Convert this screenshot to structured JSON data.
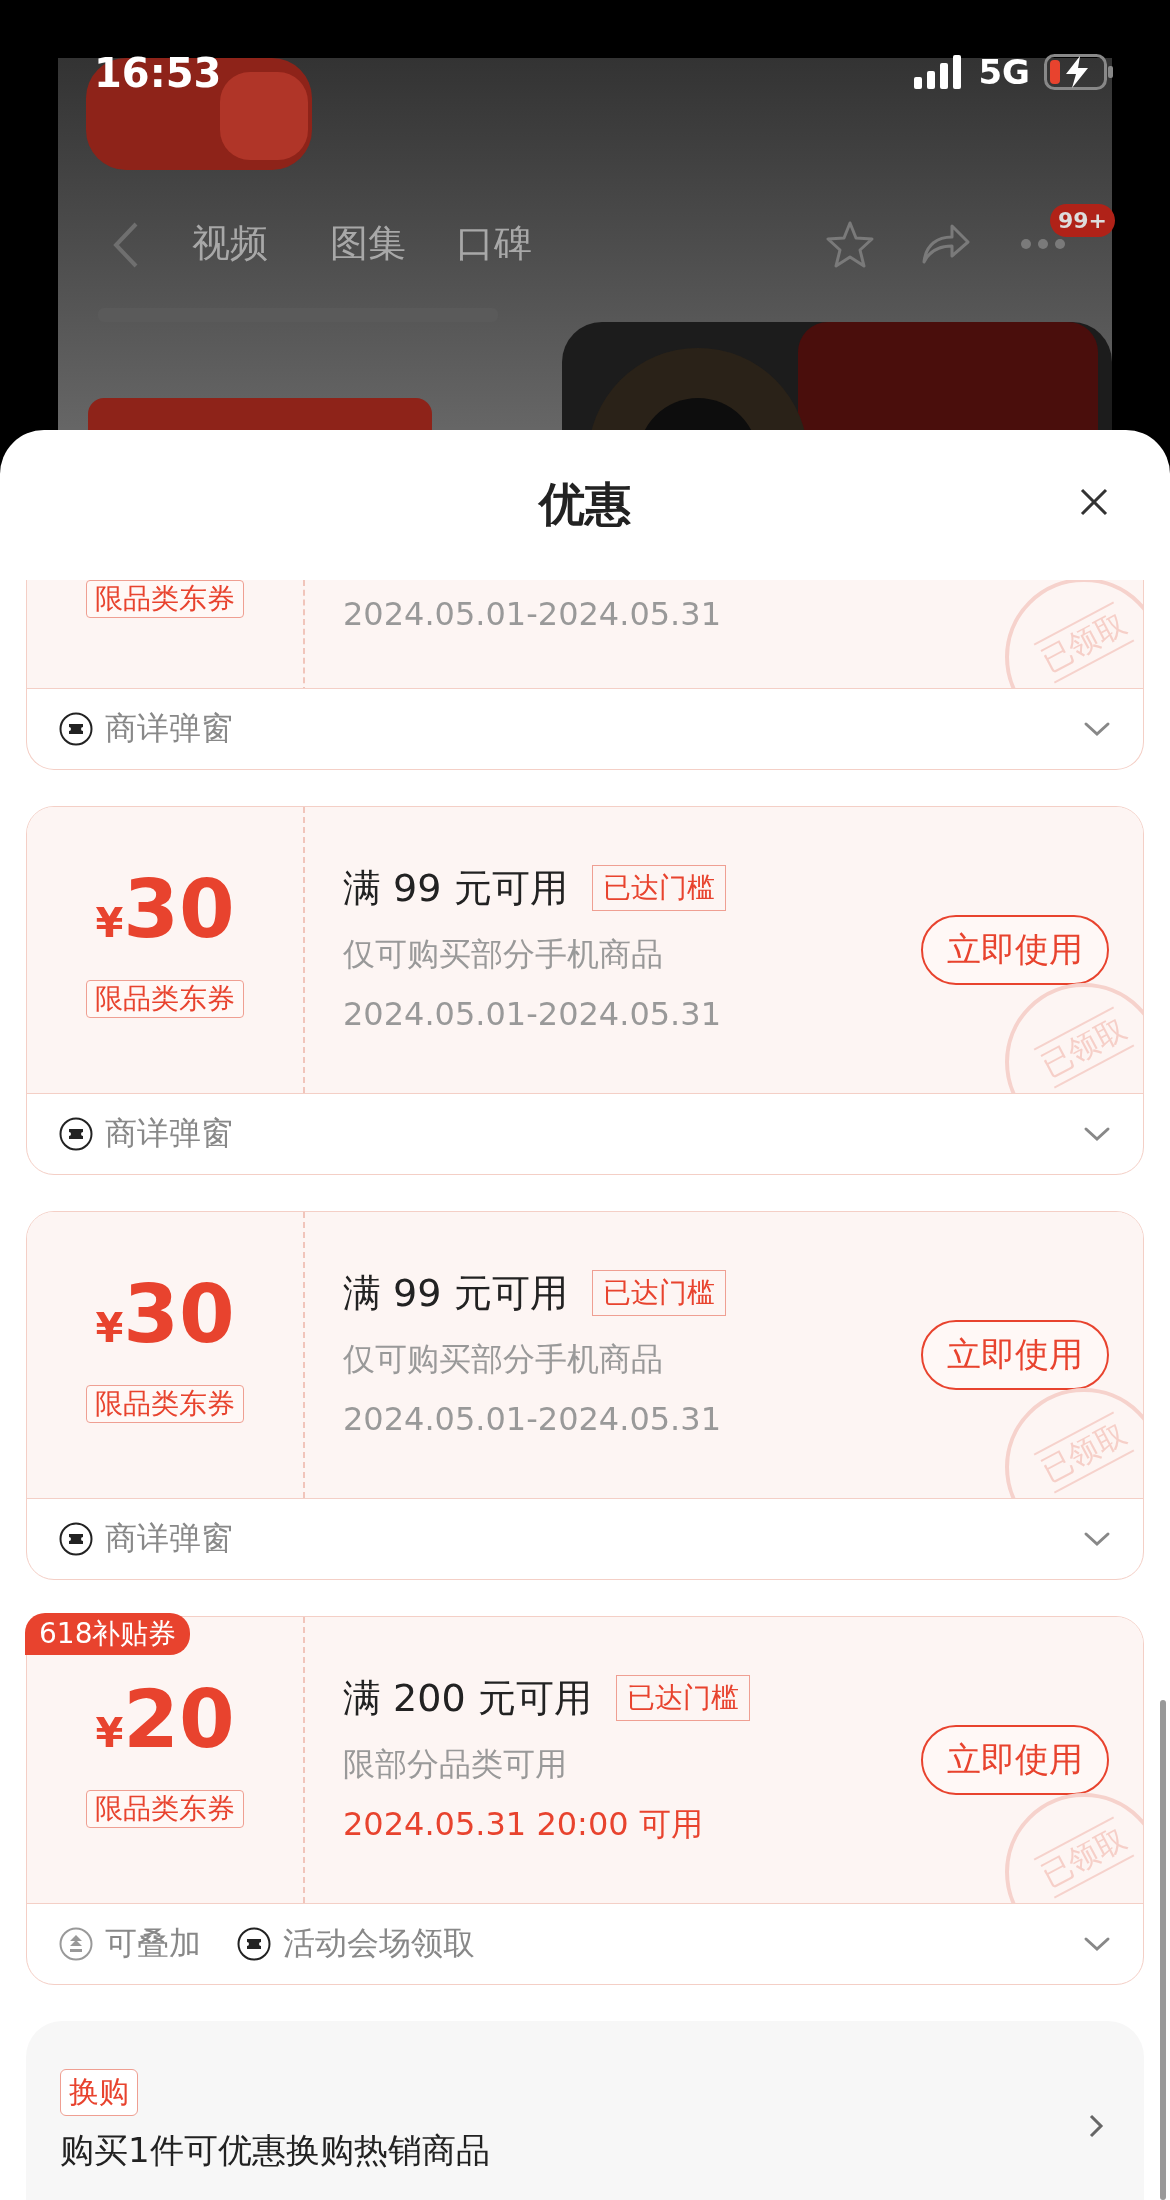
{
  "status_bar": {
    "time": "16:53",
    "network": "5G"
  },
  "nav": {
    "tabs": [
      {
        "label": "视频"
      },
      {
        "label": "图集"
      },
      {
        "label": "口碑"
      }
    ],
    "badge": "99+"
  },
  "sheet": {
    "title": "优惠"
  },
  "coupons": [
    {
      "tag": "限品类东券",
      "date": {
        "text": "2024.05.01-2024.05.31",
        "highlight": false
      },
      "stamp": "已领取",
      "footer": [
        {
          "kind": "ticket",
          "text": "商详弹窗"
        }
      ]
    },
    {
      "currency": "¥",
      "amount": "30",
      "tag": "限品类东券",
      "title": "满 99 元可用",
      "badge": "已达门槛",
      "desc": "仅可购买部分手机商品",
      "date": {
        "text": "2024.05.01-2024.05.31",
        "highlight": false
      },
      "action": "立即使用",
      "stamp": "已领取",
      "footer": [
        {
          "kind": "ticket",
          "text": "商详弹窗"
        }
      ]
    },
    {
      "currency": "¥",
      "amount": "30",
      "tag": "限品类东券",
      "title": "满 99 元可用",
      "badge": "已达门槛",
      "desc": "仅可购买部分手机商品",
      "date": {
        "text": "2024.05.01-2024.05.31",
        "highlight": false
      },
      "action": "立即使用",
      "stamp": "已领取",
      "footer": [
        {
          "kind": "ticket",
          "text": "商详弹窗"
        }
      ]
    },
    {
      "corner_badge": "618补贴券",
      "currency": "¥",
      "amount": "20",
      "tag": "限品类东券",
      "title": "满 200 元可用",
      "badge": "已达门槛",
      "desc": "限部分品类可用",
      "date": {
        "text": "2024.05.31 20:00 可用",
        "highlight": true
      },
      "action": "立即使用",
      "stamp": "已领取",
      "footer": [
        {
          "kind": "stack",
          "text": "可叠加"
        },
        {
          "kind": "ticket",
          "text": "活动会场领取"
        }
      ]
    }
  ],
  "exchange": {
    "tag": "换购",
    "text": "购买1件可优惠换购热销商品"
  }
}
